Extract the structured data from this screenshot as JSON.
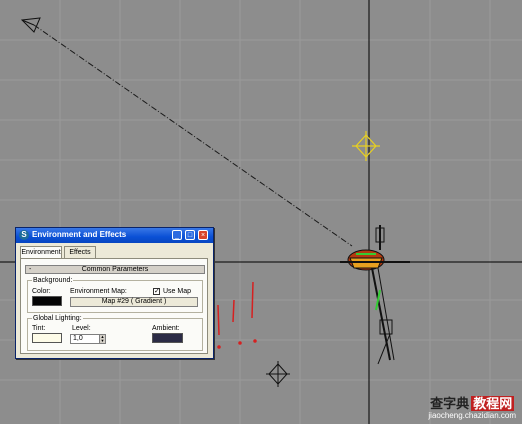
{
  "dialog": {
    "title": "Environment and Effects",
    "tabs": [
      "Environment",
      "Effects"
    ],
    "rollout": {
      "sign": "-",
      "label": "Common Parameters"
    },
    "background": {
      "group_label": "Background:",
      "color_label": "Color:",
      "env_map_label": "Environment Map:",
      "use_map_label": "Use Map",
      "use_map_checked": true,
      "map_button": "Map #29  ( Gradient )",
      "color": "#050505"
    },
    "lighting": {
      "group_label": "Global Lighting:",
      "tint_label": "Tint:",
      "level_label": "Level:",
      "level_value": "1,0",
      "ambient_label": "Ambient:",
      "tint_color": "#fdfbe8",
      "ambient_color": "#2b2b45"
    }
  },
  "viewport": {
    "background_color": "#8d8d8d",
    "annotation_color": "#d62020",
    "light_color": "#e8d020"
  },
  "watermark": {
    "brand_left": "查字典",
    "brand_right": "教程网",
    "url": "jiaocheng.chazidian.com"
  }
}
